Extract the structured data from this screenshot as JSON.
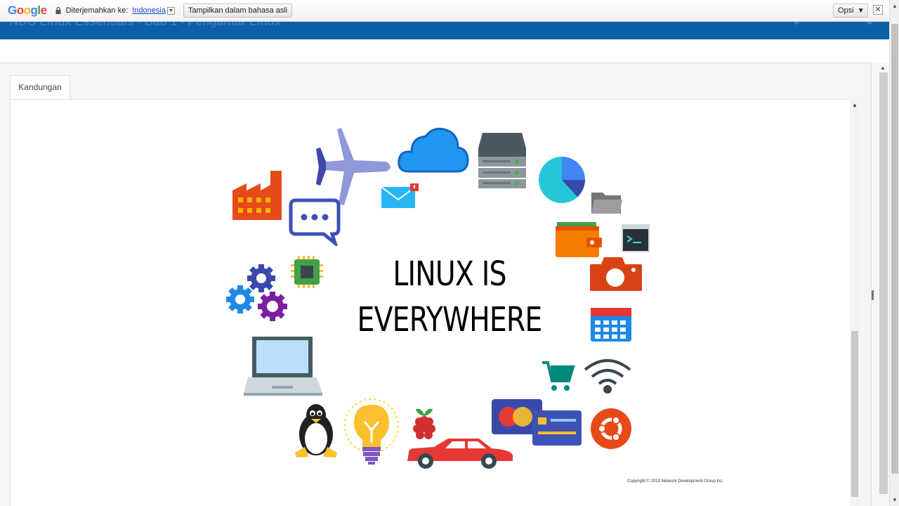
{
  "translate_bar": {
    "logo_letters": [
      "G",
      "o",
      "o",
      "g",
      "l",
      "e"
    ],
    "logo_colors": [
      "#4285f4",
      "#ea4335",
      "#fbbc05",
      "#4285f4",
      "#34a853",
      "#ea4335"
    ],
    "label": "Diterjemahkan ke:",
    "language": "Indonesia",
    "show_original": "Tampilkan dalam bahasa asli",
    "options": "Opsi",
    "options_caret": "▼",
    "close": "✕"
  },
  "header": {
    "ghost_text": "NDG Linux Essentials - Bab 1 - Pengantar Linux",
    "color": "#0b5ea8"
  },
  "tabs": [
    {
      "label": "Kandungan"
    }
  ],
  "slide": {
    "title_line1": "LINUX IS",
    "title_line2": "EVERYWHERE",
    "copyright": "Copyright © 2019 Network Development Group Inc.",
    "icons": [
      "airplane-icon",
      "cloud-icon",
      "server-icon",
      "pie-chart-icon",
      "factory-icon",
      "mail-icon",
      "chat-bubble-icon",
      "folder-icon",
      "wallet-icon",
      "terminal-icon",
      "chip-icon",
      "gears-icon",
      "camera-icon",
      "calendar-icon",
      "laptop-icon",
      "cart-icon",
      "wifi-icon",
      "tux-penguin-icon",
      "lightbulb-icon",
      "raspberry-pi-icon",
      "credit-cards-icon",
      "ubuntu-icon",
      "car-icon"
    ]
  }
}
